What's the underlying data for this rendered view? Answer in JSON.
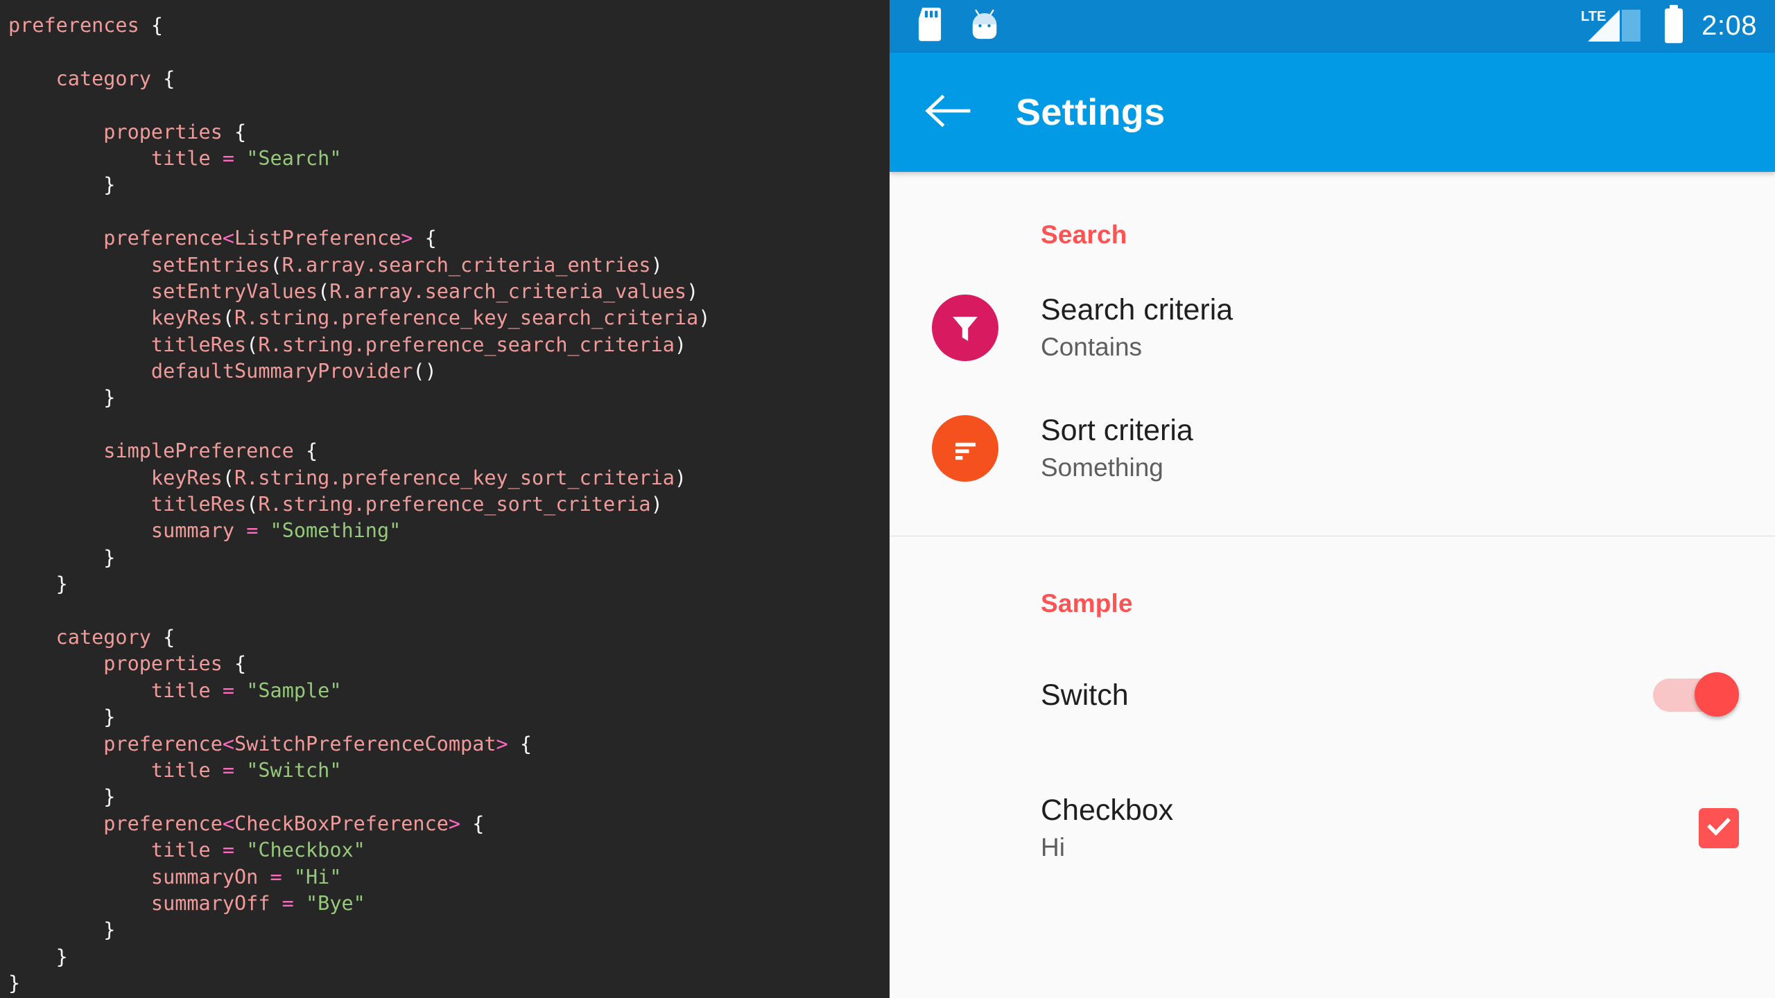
{
  "editor": {
    "language": "kotlin",
    "background": "#262626",
    "colors": {
      "identifier": "#f29b9b",
      "punctuation": "#f7f7f7",
      "string": "#97c97c",
      "operator": "#ff6ac1"
    },
    "code_lines": [
      [
        {
          "t": "preferences",
          "c": "id"
        },
        {
          "t": " ",
          "c": "punc"
        },
        {
          "t": "{",
          "c": "punc"
        }
      ],
      [],
      [
        {
          "t": "    ",
          "c": "punc"
        },
        {
          "t": "category",
          "c": "id"
        },
        {
          "t": " ",
          "c": "punc"
        },
        {
          "t": "{",
          "c": "punc"
        }
      ],
      [],
      [
        {
          "t": "        ",
          "c": "punc"
        },
        {
          "t": "properties",
          "c": "id"
        },
        {
          "t": " ",
          "c": "punc"
        },
        {
          "t": "{",
          "c": "punc"
        }
      ],
      [
        {
          "t": "            ",
          "c": "punc"
        },
        {
          "t": "title",
          "c": "id"
        },
        {
          "t": " ",
          "c": "punc"
        },
        {
          "t": "=",
          "c": "op"
        },
        {
          "t": " ",
          "c": "punc"
        },
        {
          "t": "\"Search\"",
          "c": "str"
        }
      ],
      [
        {
          "t": "        ",
          "c": "punc"
        },
        {
          "t": "}",
          "c": "punc"
        }
      ],
      [],
      [
        {
          "t": "        ",
          "c": "punc"
        },
        {
          "t": "preference",
          "c": "id"
        },
        {
          "t": "<",
          "c": "op"
        },
        {
          "t": "ListPreference",
          "c": "id"
        },
        {
          "t": ">",
          "c": "op"
        },
        {
          "t": " ",
          "c": "punc"
        },
        {
          "t": "{",
          "c": "punc"
        }
      ],
      [
        {
          "t": "            ",
          "c": "punc"
        },
        {
          "t": "setEntries",
          "c": "id"
        },
        {
          "t": "(",
          "c": "punc"
        },
        {
          "t": "R.array.search_criteria_entries",
          "c": "id"
        },
        {
          "t": ")",
          "c": "punc"
        }
      ],
      [
        {
          "t": "            ",
          "c": "punc"
        },
        {
          "t": "setEntryValues",
          "c": "id"
        },
        {
          "t": "(",
          "c": "punc"
        },
        {
          "t": "R.array.search_criteria_values",
          "c": "id"
        },
        {
          "t": ")",
          "c": "punc"
        }
      ],
      [
        {
          "t": "            ",
          "c": "punc"
        },
        {
          "t": "keyRes",
          "c": "id"
        },
        {
          "t": "(",
          "c": "punc"
        },
        {
          "t": "R.string.preference_key_search_criteria",
          "c": "id"
        },
        {
          "t": ")",
          "c": "punc"
        }
      ],
      [
        {
          "t": "            ",
          "c": "punc"
        },
        {
          "t": "titleRes",
          "c": "id"
        },
        {
          "t": "(",
          "c": "punc"
        },
        {
          "t": "R.string.preference_search_criteria",
          "c": "id"
        },
        {
          "t": ")",
          "c": "punc"
        }
      ],
      [
        {
          "t": "            ",
          "c": "punc"
        },
        {
          "t": "defaultSummaryProvider",
          "c": "id"
        },
        {
          "t": "()",
          "c": "punc"
        }
      ],
      [
        {
          "t": "        ",
          "c": "punc"
        },
        {
          "t": "}",
          "c": "punc"
        }
      ],
      [],
      [
        {
          "t": "        ",
          "c": "punc"
        },
        {
          "t": "simplePreference",
          "c": "id"
        },
        {
          "t": " ",
          "c": "punc"
        },
        {
          "t": "{",
          "c": "punc"
        }
      ],
      [
        {
          "t": "            ",
          "c": "punc"
        },
        {
          "t": "keyRes",
          "c": "id"
        },
        {
          "t": "(",
          "c": "punc"
        },
        {
          "t": "R.string.preference_key_sort_criteria",
          "c": "id"
        },
        {
          "t": ")",
          "c": "punc"
        }
      ],
      [
        {
          "t": "            ",
          "c": "punc"
        },
        {
          "t": "titleRes",
          "c": "id"
        },
        {
          "t": "(",
          "c": "punc"
        },
        {
          "t": "R.string.preference_sort_criteria",
          "c": "id"
        },
        {
          "t": ")",
          "c": "punc"
        }
      ],
      [
        {
          "t": "            ",
          "c": "punc"
        },
        {
          "t": "summary",
          "c": "id"
        },
        {
          "t": " ",
          "c": "punc"
        },
        {
          "t": "=",
          "c": "op"
        },
        {
          "t": " ",
          "c": "punc"
        },
        {
          "t": "\"Something\"",
          "c": "str"
        }
      ],
      [
        {
          "t": "        ",
          "c": "punc"
        },
        {
          "t": "}",
          "c": "punc"
        }
      ],
      [
        {
          "t": "    ",
          "c": "punc"
        },
        {
          "t": "}",
          "c": "punc"
        }
      ],
      [],
      [
        {
          "t": "    ",
          "c": "punc"
        },
        {
          "t": "category",
          "c": "id"
        },
        {
          "t": " ",
          "c": "punc"
        },
        {
          "t": "{",
          "c": "punc"
        }
      ],
      [
        {
          "t": "        ",
          "c": "punc"
        },
        {
          "t": "properties",
          "c": "id"
        },
        {
          "t": " ",
          "c": "punc"
        },
        {
          "t": "{",
          "c": "punc"
        }
      ],
      [
        {
          "t": "            ",
          "c": "punc"
        },
        {
          "t": "title",
          "c": "id"
        },
        {
          "t": " ",
          "c": "punc"
        },
        {
          "t": "=",
          "c": "op"
        },
        {
          "t": " ",
          "c": "punc"
        },
        {
          "t": "\"Sample\"",
          "c": "str"
        }
      ],
      [
        {
          "t": "        ",
          "c": "punc"
        },
        {
          "t": "}",
          "c": "punc"
        }
      ],
      [
        {
          "t": "        ",
          "c": "punc"
        },
        {
          "t": "preference",
          "c": "id"
        },
        {
          "t": "<",
          "c": "op"
        },
        {
          "t": "SwitchPreferenceCompat",
          "c": "id"
        },
        {
          "t": ">",
          "c": "op"
        },
        {
          "t": " ",
          "c": "punc"
        },
        {
          "t": "{",
          "c": "punc"
        }
      ],
      [
        {
          "t": "            ",
          "c": "punc"
        },
        {
          "t": "title",
          "c": "id"
        },
        {
          "t": " ",
          "c": "punc"
        },
        {
          "t": "=",
          "c": "op"
        },
        {
          "t": " ",
          "c": "punc"
        },
        {
          "t": "\"Switch\"",
          "c": "str"
        }
      ],
      [
        {
          "t": "        ",
          "c": "punc"
        },
        {
          "t": "}",
          "c": "punc"
        }
      ],
      [
        {
          "t": "        ",
          "c": "punc"
        },
        {
          "t": "preference",
          "c": "id"
        },
        {
          "t": "<",
          "c": "op"
        },
        {
          "t": "CheckBoxPreference",
          "c": "id"
        },
        {
          "t": ">",
          "c": "op"
        },
        {
          "t": " ",
          "c": "punc"
        },
        {
          "t": "{",
          "c": "punc"
        }
      ],
      [
        {
          "t": "            ",
          "c": "punc"
        },
        {
          "t": "title",
          "c": "id"
        },
        {
          "t": " ",
          "c": "punc"
        },
        {
          "t": "=",
          "c": "op"
        },
        {
          "t": " ",
          "c": "punc"
        },
        {
          "t": "\"Checkbox\"",
          "c": "str"
        }
      ],
      [
        {
          "t": "            ",
          "c": "punc"
        },
        {
          "t": "summaryOn",
          "c": "id"
        },
        {
          "t": " ",
          "c": "punc"
        },
        {
          "t": "=",
          "c": "op"
        },
        {
          "t": " ",
          "c": "punc"
        },
        {
          "t": "\"Hi\"",
          "c": "str"
        }
      ],
      [
        {
          "t": "            ",
          "c": "punc"
        },
        {
          "t": "summaryOff",
          "c": "id"
        },
        {
          "t": " ",
          "c": "punc"
        },
        {
          "t": "=",
          "c": "op"
        },
        {
          "t": " ",
          "c": "punc"
        },
        {
          "t": "\"Bye\"",
          "c": "str"
        }
      ],
      [
        {
          "t": "        ",
          "c": "punc"
        },
        {
          "t": "}",
          "c": "punc"
        }
      ],
      [
        {
          "t": "    ",
          "c": "punc"
        },
        {
          "t": "}",
          "c": "punc"
        }
      ],
      [
        {
          "t": "}",
          "c": "punc"
        }
      ]
    ]
  },
  "phone": {
    "statusbar": {
      "background": "#0b86ce",
      "icons": [
        "sd-card-icon",
        "android-head-icon",
        "lte-signal-icon",
        "battery-full-icon"
      ],
      "network_label": "LTE",
      "time": "2:08"
    },
    "toolbar": {
      "background": "#039ae5",
      "back_label": "Back",
      "title": "Settings"
    },
    "sections": [
      {
        "header": "Search",
        "header_color": "#ff5252",
        "items": [
          {
            "icon": "filter-funnel-icon",
            "icon_color": "#d81b60",
            "title": "Search criteria",
            "summary": "Contains",
            "widget": "none"
          },
          {
            "icon": "sort-lines-icon",
            "icon_color": "#f4511e",
            "title": "Sort criteria",
            "summary": "Something",
            "widget": "none"
          }
        ]
      },
      {
        "header": "Sample",
        "header_color": "#ff5252",
        "items": [
          {
            "icon": "none",
            "title": "Switch",
            "summary": "",
            "widget": "switch",
            "widget_state": "on",
            "widget_color": "#ff4a4a"
          },
          {
            "icon": "none",
            "title": "Checkbox",
            "summary": "Hi",
            "widget": "checkbox",
            "widget_state": "checked",
            "widget_color": "#ff5252"
          }
        ]
      }
    ]
  }
}
